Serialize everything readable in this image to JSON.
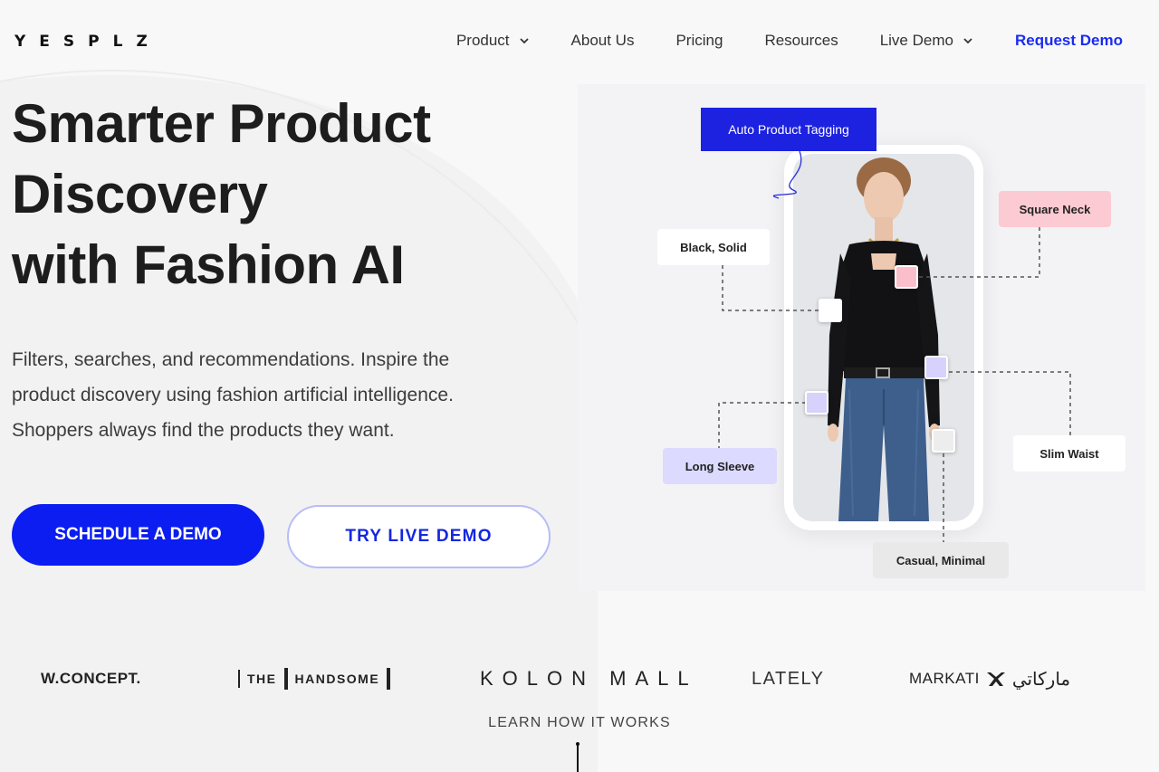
{
  "header": {
    "logo": "YESPLZ",
    "nav": [
      {
        "label": "Product",
        "has_dropdown": true
      },
      {
        "label": "About Us",
        "has_dropdown": false
      },
      {
        "label": "Pricing",
        "has_dropdown": false
      },
      {
        "label": "Resources",
        "has_dropdown": false
      },
      {
        "label": "Live Demo",
        "has_dropdown": true
      }
    ],
    "cta": "Request Demo"
  },
  "hero": {
    "title_lines": [
      "Smarter Product",
      "Discovery",
      "with Fashion AI"
    ],
    "subtitle_lines": [
      "Filters, searches, and recommendations. Inspire the",
      "product discovery using fashion artificial intelligence.",
      "Shoppers always find the products they want."
    ],
    "primary_button": "SCHEDULE A DEMO",
    "secondary_button": "TRY LIVE DEMO"
  },
  "illustration": {
    "header_tag": "Auto Product Tagging",
    "tags": {
      "square_neck": "Square Neck",
      "black_solid": "Black, Solid",
      "long_sleeve": "Long Sleeve",
      "slim_waist": "Slim Waist",
      "casual_minimal": "Casual, Minimal"
    }
  },
  "brands": {
    "wconcept": "W.CONCEPT.",
    "handsome_the": "THE",
    "handsome_name": "HANDSOME",
    "kolon": "KOLON MALL",
    "lately": "LATELY",
    "markati_en": "MARKATI",
    "markati_ar": "ماركاتي"
  },
  "learn_more": "LEARN HOW IT WORKS",
  "colors": {
    "brand_blue": "#0b1df0",
    "tag_pink": "#fccad2",
    "tag_lavender": "#dcdafe"
  }
}
